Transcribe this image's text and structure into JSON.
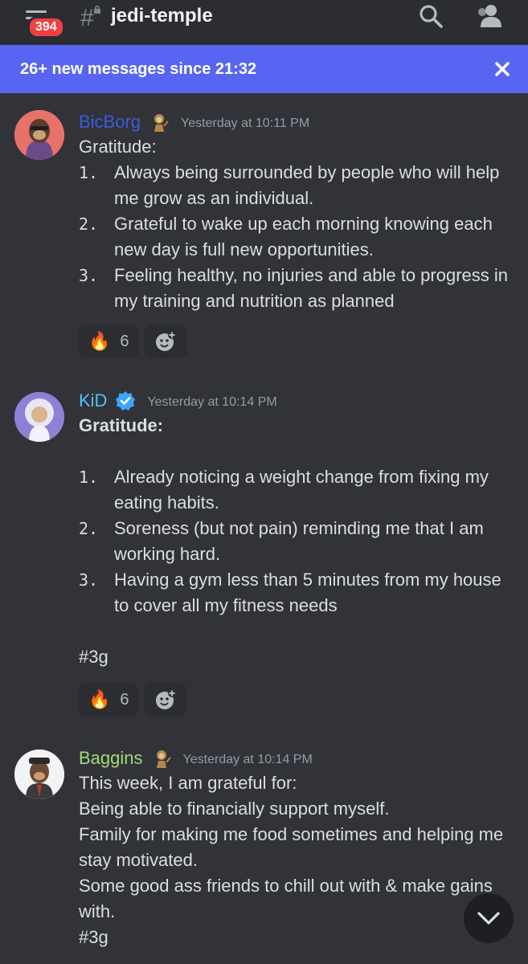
{
  "header": {
    "unread_badge": "394",
    "channel_name": "jedi-temple",
    "hash_symbol": "#",
    "icons": [
      "menu-icon",
      "hash-lock-icon",
      "search-icon",
      "members-icon"
    ]
  },
  "banner": {
    "text": "26+ new messages since 21:32",
    "close_icon": "close-icon"
  },
  "colors": {
    "background": "#313338",
    "header": "#2b2d31",
    "banner": "#5865f2",
    "badge": "#f23f43",
    "author_bicborg": "#3b5bdb",
    "author_kid": "#4fc3f7",
    "author_baggins": "#a3d977",
    "verified": "#3ba5ff"
  },
  "messages": [
    {
      "author": "BicBorg",
      "timestamp": "Yesterday at 10:11 PM",
      "role_icon": "monkey-icon",
      "lines": [
        "Gratitude:"
      ],
      "list": [
        {
          "num": "1.",
          "text": "Always being surrounded by people who will help me grow as an individual."
        },
        {
          "num": "2.",
          "text": "Grateful to wake up each morning knowing each new day is full new opportunities."
        },
        {
          "num": "3.",
          "text": "Feeling healthy, no injuries and able to progress in my training and nutrition as planned"
        }
      ],
      "reaction": {
        "emoji": "🔥",
        "count": "6"
      }
    },
    {
      "author": "KiD",
      "timestamp": "Yesterday at 10:14 PM",
      "role_icon": "verified-icon",
      "heading": "Gratitude:",
      "list": [
        {
          "num": "1.",
          "text": "Already noticing a weight change from fixing my eating habits."
        },
        {
          "num": "2.",
          "text": "Soreness (but not pain) reminding me that I am working hard."
        },
        {
          "num": "3.",
          "text": "Having a gym less than 5 minutes from my house to cover all my fitness needs"
        }
      ],
      "tag": "#3g",
      "reaction": {
        "emoji": "🔥",
        "count": "6"
      }
    },
    {
      "author": "Baggins",
      "timestamp": "Yesterday at 10:14 PM",
      "role_icon": "monkey-icon",
      "lines": [
        "This week, I am grateful for:",
        "Being able to financially support myself.",
        "Family for making me food sometimes and helping me stay motivated.",
        "Some good ass friends to chill out with & make gains with.",
        "#3g"
      ]
    }
  ],
  "scroll_button_icon": "chevron-down-icon"
}
